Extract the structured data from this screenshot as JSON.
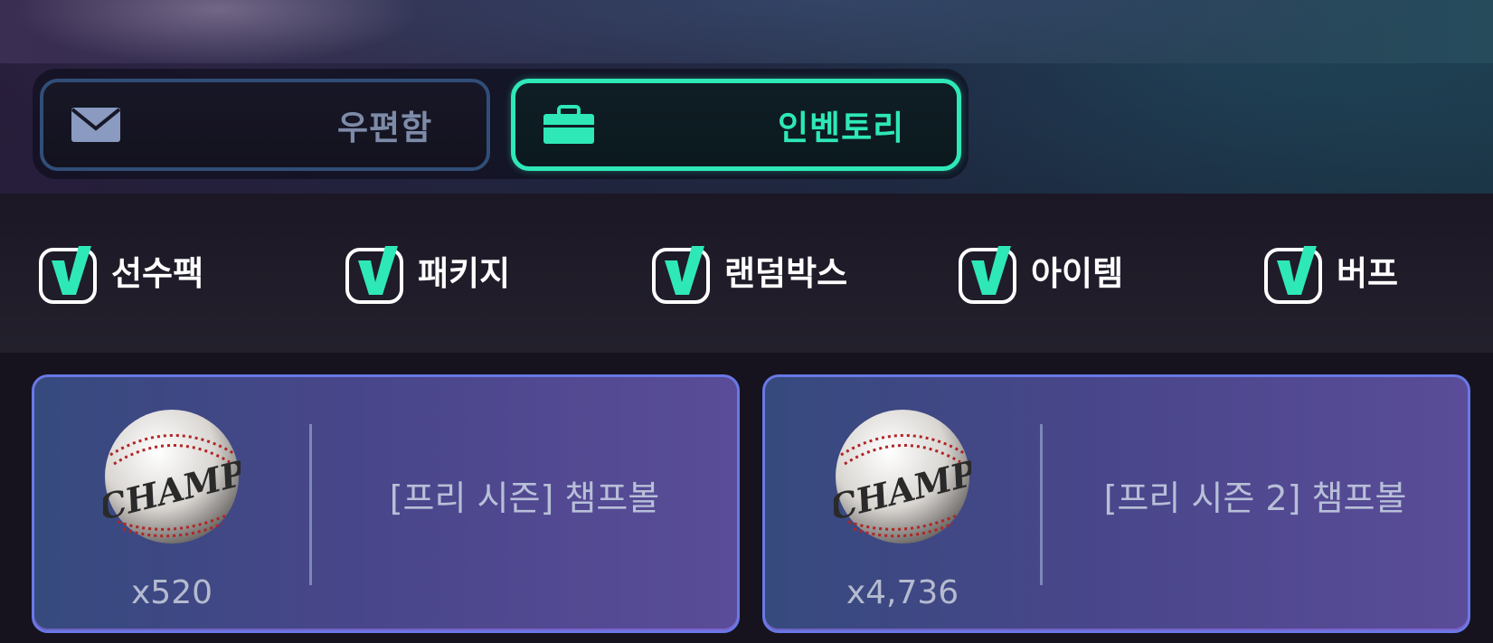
{
  "tabs": {
    "mail": {
      "label": "우편함",
      "icon": "envelope-icon",
      "active": false
    },
    "inventory": {
      "label": "인벤토리",
      "icon": "briefcase-icon",
      "active": true
    }
  },
  "filters": [
    {
      "label": "선수팩",
      "checked": true
    },
    {
      "label": "패키지",
      "checked": true
    },
    {
      "label": "랜덤박스",
      "checked": true
    },
    {
      "label": "아이템",
      "checked": true
    },
    {
      "label": "버프",
      "checked": true
    }
  ],
  "items": [
    {
      "name": "[프리 시즌] 챔프볼",
      "count": "x520",
      "icon": "champ-baseball-icon",
      "ball_text": "CHAMP"
    },
    {
      "name": "[프리 시즌 2] 챔프볼",
      "count": "x4,736",
      "icon": "champ-baseball-icon",
      "ball_text": "CHAMP"
    }
  ],
  "colors": {
    "accent": "#2ee8b8",
    "inactive_tab_border": "#314e78",
    "card_border": "#6a78e6"
  }
}
